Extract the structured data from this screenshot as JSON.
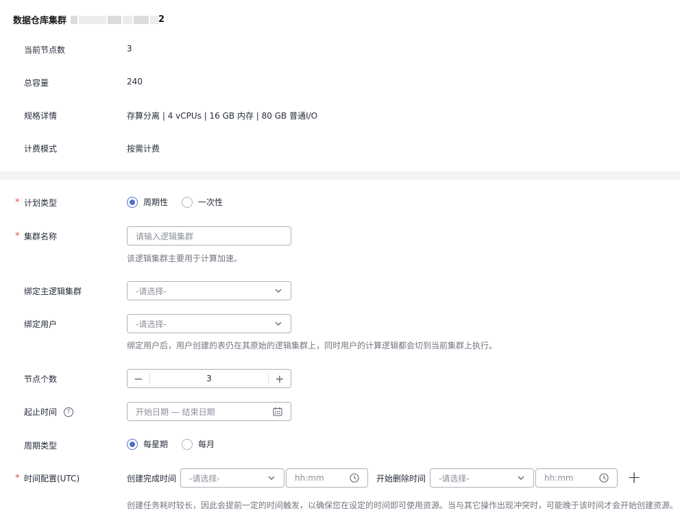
{
  "header": {
    "title": "数据仓库集群",
    "title_suffix": "2"
  },
  "info": {
    "node_count_label": "当前节点数",
    "node_count_value": "3",
    "capacity_label": "总容量",
    "capacity_value": "240",
    "spec_label": "规格详情",
    "spec_value": "存算分离 | 4 vCPUs | 16 GB 内存 | 80 GB 普通I/O",
    "billing_label": "计费模式",
    "billing_value": "按需计费"
  },
  "form": {
    "required_mark": "*",
    "plan_type_label": "计划类型",
    "plan_type_options": [
      "周期性",
      "一次性"
    ],
    "plan_type_selected": "周期性",
    "cluster_name_label": "集群名称",
    "cluster_name_placeholder": "请输入逻辑集群",
    "cluster_name_value": "",
    "cluster_name_hint": "该逻辑集群主要用于计算加速。",
    "bind_main_label": "绑定主逻辑集群",
    "bind_main_value": "-请选择-",
    "bind_user_label": "绑定用户",
    "bind_user_value": "-请选择-",
    "bind_user_hint": "绑定用户后，用户创建的表仍在其原始的逻辑集群上，同时用户的计算逻辑都会切到当前集群上执行。",
    "node_num_label": "节点个数",
    "node_num_value": "3",
    "node_num_minus": "−",
    "node_num_plus": "+",
    "date_range_label": "起止时间",
    "date_range_help": "?",
    "date_range_value": "开始日期 — 结束日期",
    "cycle_type_label": "周期类型",
    "cycle_type_options": [
      "每星期",
      "每月"
    ],
    "cycle_type_selected": "每星期",
    "time_config_label": "时间配置(UTC)",
    "create_done_label": "创建完成时间",
    "create_select_value": "-请选择-",
    "create_time_placeholder": "hh:mm",
    "delete_start_label": "开始删除时间",
    "delete_select_value": "-请选择-",
    "delete_time_placeholder": "hh:mm",
    "add_symbol": "+",
    "time_hint": "创建任务耗时较长，因此会提前一定的时间触发，以确保您在设定的时间即可使用资源。当与其它操作出现冲突时，可能晚于该时间才会开始创建资源。"
  },
  "colors": {
    "accent": "#526ecc",
    "required": "#e6483a",
    "border": "#adb0b8",
    "divider": "#f3f3f3"
  }
}
